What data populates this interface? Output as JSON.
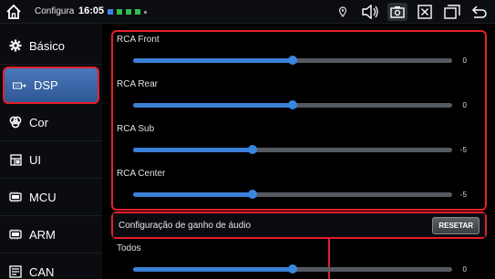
{
  "statusbar": {
    "title": "Configura",
    "time": "16:05",
    "dots": [
      "#3b86e0",
      "#30c04a",
      "#30c04a",
      "#30c04a",
      "#888888"
    ]
  },
  "sidebar": {
    "items": [
      {
        "label": "Básico",
        "icon": "gear-icon"
      },
      {
        "label": "DSP",
        "icon": "dsp-icon",
        "active": true
      },
      {
        "label": "Cor",
        "icon": "palette-icon"
      },
      {
        "label": "UI",
        "icon": "ui-icon"
      },
      {
        "label": "MCU",
        "icon": "chip-icon"
      },
      {
        "label": "ARM",
        "icon": "chip-icon"
      },
      {
        "label": "CAN",
        "icon": "can-icon"
      }
    ]
  },
  "sliders": [
    {
      "label": "RCA Front",
      "value": "0",
      "fraction": 0.5
    },
    {
      "label": "RCA Rear",
      "value": "0",
      "fraction": 0.5
    },
    {
      "label": "RCA Sub",
      "value": "-5",
      "fraction": 0.375
    },
    {
      "label": "RCA Center",
      "value": "-5",
      "fraction": 0.375
    }
  ],
  "gain": {
    "label": "Configuração de ganho de áudio",
    "reset_label": "RESETAR"
  },
  "todos": {
    "label": "Todos",
    "value": "0",
    "fraction": 0.5
  },
  "colors": {
    "accent": "#3b86e0",
    "highlight": "#e51f2b",
    "active_tab": "#3f6aaa"
  }
}
